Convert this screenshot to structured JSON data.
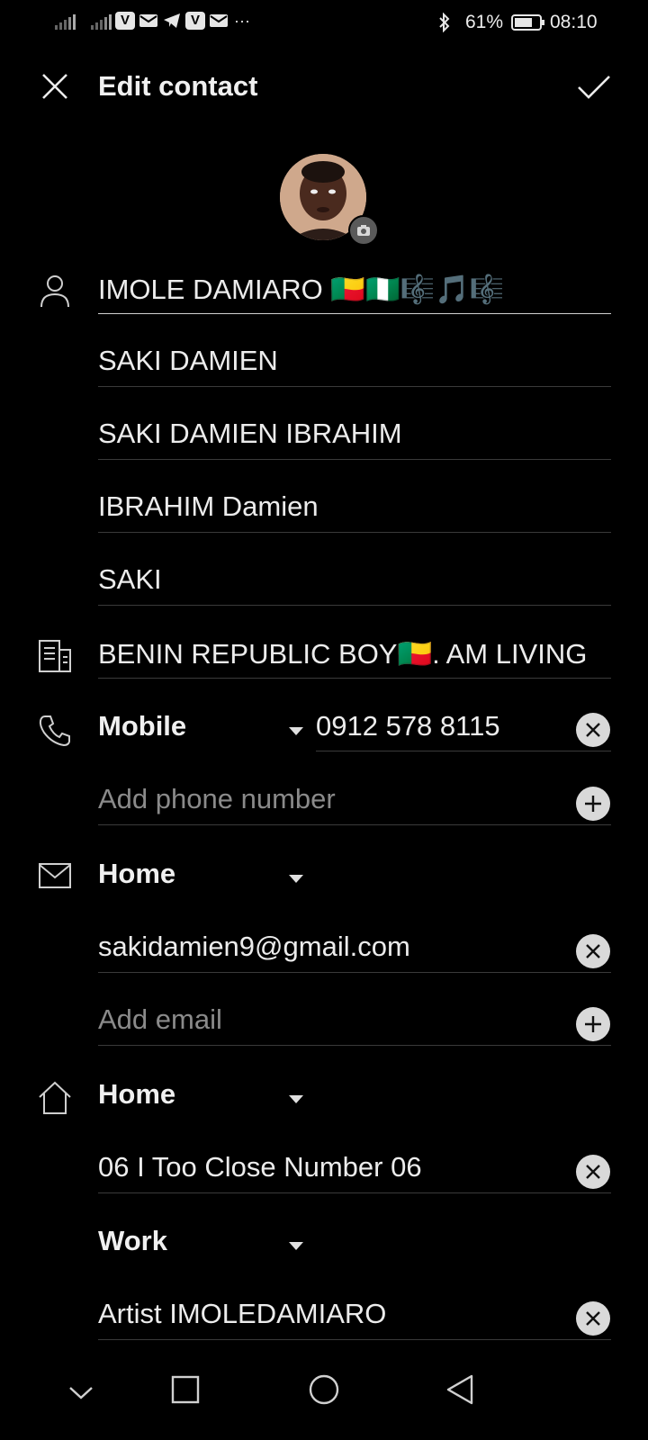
{
  "status_bar": {
    "battery_percent": "61%",
    "time": "08:10",
    "notif_v1": "V",
    "notif_v2": "V",
    "more": "···"
  },
  "header": {
    "title": "Edit contact",
    "close_icon": "close-icon",
    "confirm_icon": "check-icon"
  },
  "name_fields": [
    "IMOLE DAMIARO 🇧🇯🇳🇬🎼🎵🎼",
    "SAKI DAMIEN",
    "SAKI DAMIEN IBRAHIM",
    "IBRAHIM Damien",
    "SAKI"
  ],
  "note": "BENIN REPUBLIC BOY🇧🇯. AM LIVING",
  "phone": {
    "type_label": "Mobile",
    "number": "0912 578 8115",
    "add_placeholder": "Add phone number"
  },
  "email": {
    "type_label": "Home",
    "value": "sakidamien9@gmail.com",
    "add_placeholder": "Add email"
  },
  "address": {
    "type_label": "Home",
    "value": "06 I Too Close Number 06"
  },
  "work": {
    "type_label": "Work",
    "value": "Artist IMOLEDAMIARO"
  }
}
